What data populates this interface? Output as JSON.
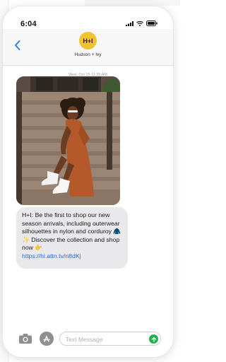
{
  "status_bar": {
    "time": "6:04"
  },
  "conversation": {
    "avatar_initials": "H+I",
    "contact_name": "Hudson + Ivy",
    "timestamp": "Wed, Oct 15 11:35 AM"
  },
  "message": {
    "text": "H+I: Be the first to shop our new season arrivals, including outerwear silhouettes in nylon and corduroy 🧥✨ Discover the collection and shop now 👉",
    "link": "https://hi.attn.tv/n8dKj"
  },
  "composer": {
    "placeholder": "Text Message"
  },
  "colors": {
    "avatar_bg": "#f1c232",
    "link": "#2b6fd6",
    "bubble_bg": "#e9e9eb",
    "send_button": "#22b14c",
    "back_chevron": "#2b7cf0"
  },
  "icons": [
    "signal-icon",
    "wifi-icon",
    "battery-icon",
    "back-chevron-icon",
    "camera-icon",
    "app-store-icon",
    "send-arrow-icon"
  ]
}
